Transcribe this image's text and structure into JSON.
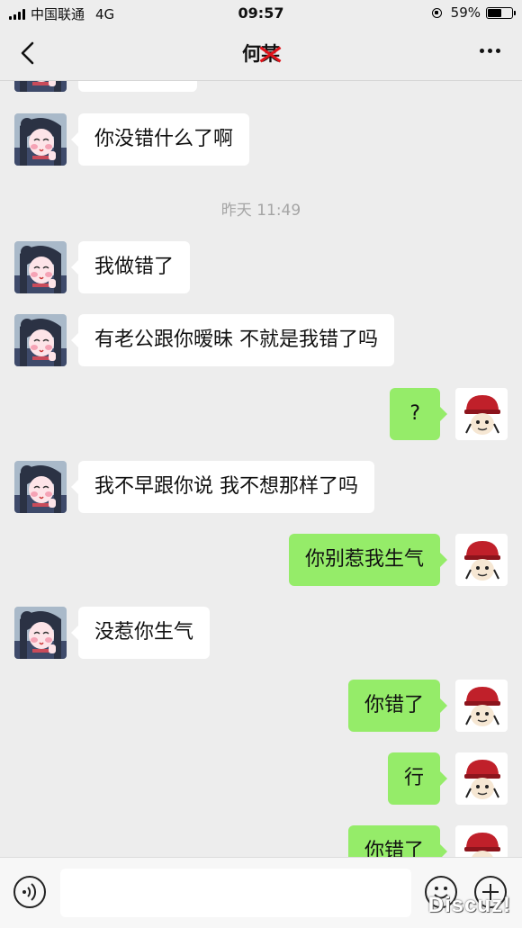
{
  "status_bar": {
    "carrier": "中国联通",
    "network": "4G",
    "time": "09:57",
    "battery": "59%",
    "battery_level": 0.59
  },
  "header": {
    "title_visible": "何",
    "title_redacted": "某"
  },
  "chat": {
    "partial_top_message": {
      "sender": "contact",
      "text": ""
    },
    "messages": [
      {
        "sender": "contact",
        "text": "你没错什么了啊"
      },
      {
        "type": "timestamp",
        "text": "昨天 11:49"
      },
      {
        "sender": "contact",
        "text": "我做错了"
      },
      {
        "sender": "contact",
        "text": "有老公跟你暧昧 不就是我错了吗"
      },
      {
        "sender": "me",
        "text": "?"
      },
      {
        "sender": "contact",
        "text": "我不早跟你说 我不想那样了吗"
      },
      {
        "sender": "me",
        "text": "你别惹我生气"
      },
      {
        "sender": "contact",
        "text": "没惹你生气"
      },
      {
        "sender": "me",
        "text": "你错了"
      },
      {
        "sender": "me",
        "text": "行"
      },
      {
        "sender": "me",
        "text": "你错了"
      }
    ]
  },
  "input_bar": {
    "value": ""
  },
  "watermark": "Discuz!",
  "colors": {
    "background": "#ededed",
    "incoming_bubble": "#ffffff",
    "outgoing_bubble": "#95ec69",
    "redaction": "#e0141b"
  }
}
